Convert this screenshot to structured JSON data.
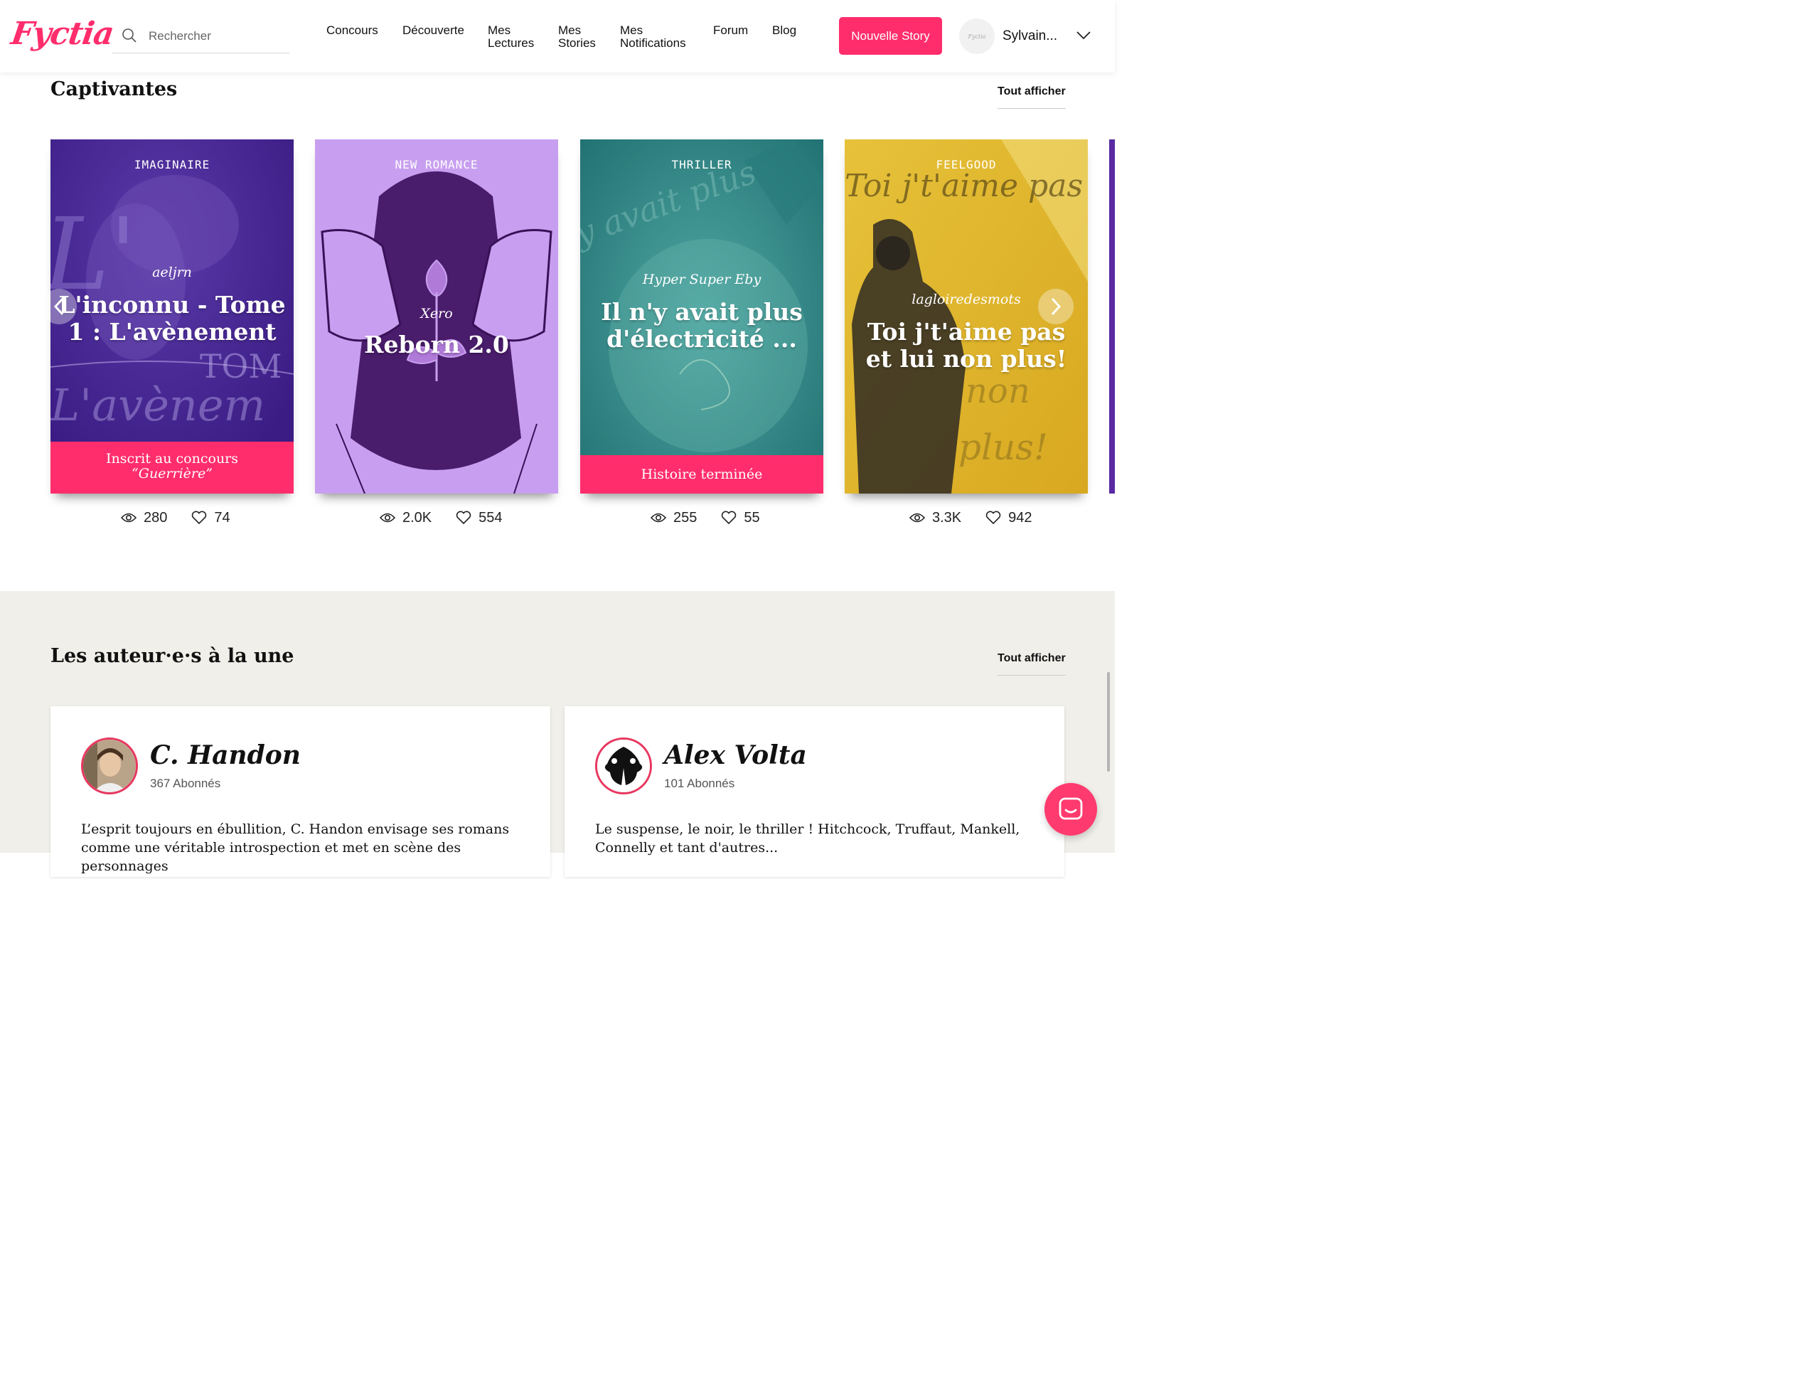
{
  "header": {
    "logo": "Fyctia",
    "search": {
      "placeholder": "Rechercher"
    },
    "nav": [
      "Concours",
      "Découverte",
      "Mes Lectures",
      "Mes Stories",
      "Mes Notifications",
      "Forum",
      "Blog"
    ],
    "new_story": "Nouvelle Story",
    "avatar_text": "Fyctia",
    "user_name": "Sylvain..."
  },
  "section1": {
    "title": "Captivantes",
    "see_all": "Tout afficher",
    "cards": [
      {
        "genre": "IMAGINAIRE",
        "author": "aeljrn",
        "title": "L'inconnu - Tome 1 : L'avènement",
        "banner_line1": "Inscrit au concours",
        "banner_line2": "“Guerrière”",
        "views": "280",
        "likes": "74"
      },
      {
        "genre": "NEW ROMANCE",
        "author": "Xero",
        "title": "Reborn 2.0",
        "banner": "",
        "views": "2.0K",
        "likes": "554"
      },
      {
        "genre": "THRILLER",
        "author": "Hyper Super Eby",
        "title": "Il n'y avait plus d'électricité ...",
        "banner": "Histoire terminée",
        "views": "255",
        "likes": "55"
      },
      {
        "genre": "FEELGOOD",
        "author": "lagloiredesmots",
        "title": "Toi j't'aime pas et lui non plus!",
        "banner": "",
        "views": "3.3K",
        "likes": "942"
      }
    ]
  },
  "section2": {
    "title": "Les auteur·e·s à la une",
    "see_all": "Tout afficher",
    "authors": [
      {
        "name": "C. Handon",
        "followers": "367 Abonnés",
        "bio": "L’esprit toujours en ébullition, C. Handon envisage ses romans comme une véritable introspection et met en scène des personnages"
      },
      {
        "name": "Alex Volta",
        "followers": "101 Abonnés",
        "bio": "Le suspense, le noir, le thriller ! Hitchcock, Truffaut, Mankell, Connelly et tant d'autres..."
      }
    ]
  },
  "colors": {
    "accent": "#ff2d6c",
    "section_bg": "#f0efe9"
  },
  "icons": [
    "search-icon",
    "eye-icon",
    "heart-icon",
    "chevron-left-icon",
    "chevron-right-icon",
    "chevron-down-icon",
    "chat-icon"
  ]
}
